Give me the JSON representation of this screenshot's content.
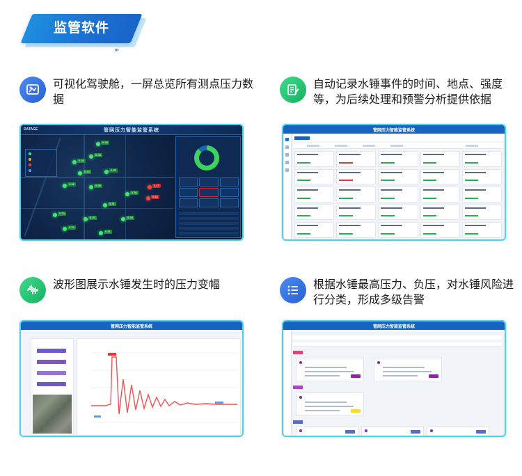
{
  "header": {
    "title": "监管软件",
    "chevrons": "›››"
  },
  "colors": {
    "accent_blue": "#1a6fd1",
    "card_border": "#4fd0e6",
    "icon_blue": "#2f6fe0",
    "icon_green": "#1fbf6a",
    "icon_purple": "#3b6be8",
    "healthy_point": "#42e86b",
    "alarm_point": "#ff4040"
  },
  "features": [
    {
      "icon": "dashboard-icon",
      "text": "可视化驾驶舱，一屏总览所有测点压力数据"
    },
    {
      "icon": "edit-record-icon",
      "text": "自动记录水锤事件的时间、地点、强度等，为后续处理和预警分析提供依据"
    },
    {
      "icon": "waveform-icon",
      "text": "波形图展示水锤发生时的压力变幅"
    },
    {
      "icon": "list-icon",
      "text": "根据水锤最高压力、负压，对水锤风险进行分类，形成多级告警"
    }
  ],
  "screens": {
    "cockpit": {
      "title": "管网压力智能监管系统",
      "logo": "DATAGE"
    },
    "records": {
      "title": "管网压力智能监管系统"
    },
    "waveform": {
      "title": "管网压力智能监管系统"
    },
    "alarms": {
      "title": "管网压力智能监管系统"
    }
  }
}
